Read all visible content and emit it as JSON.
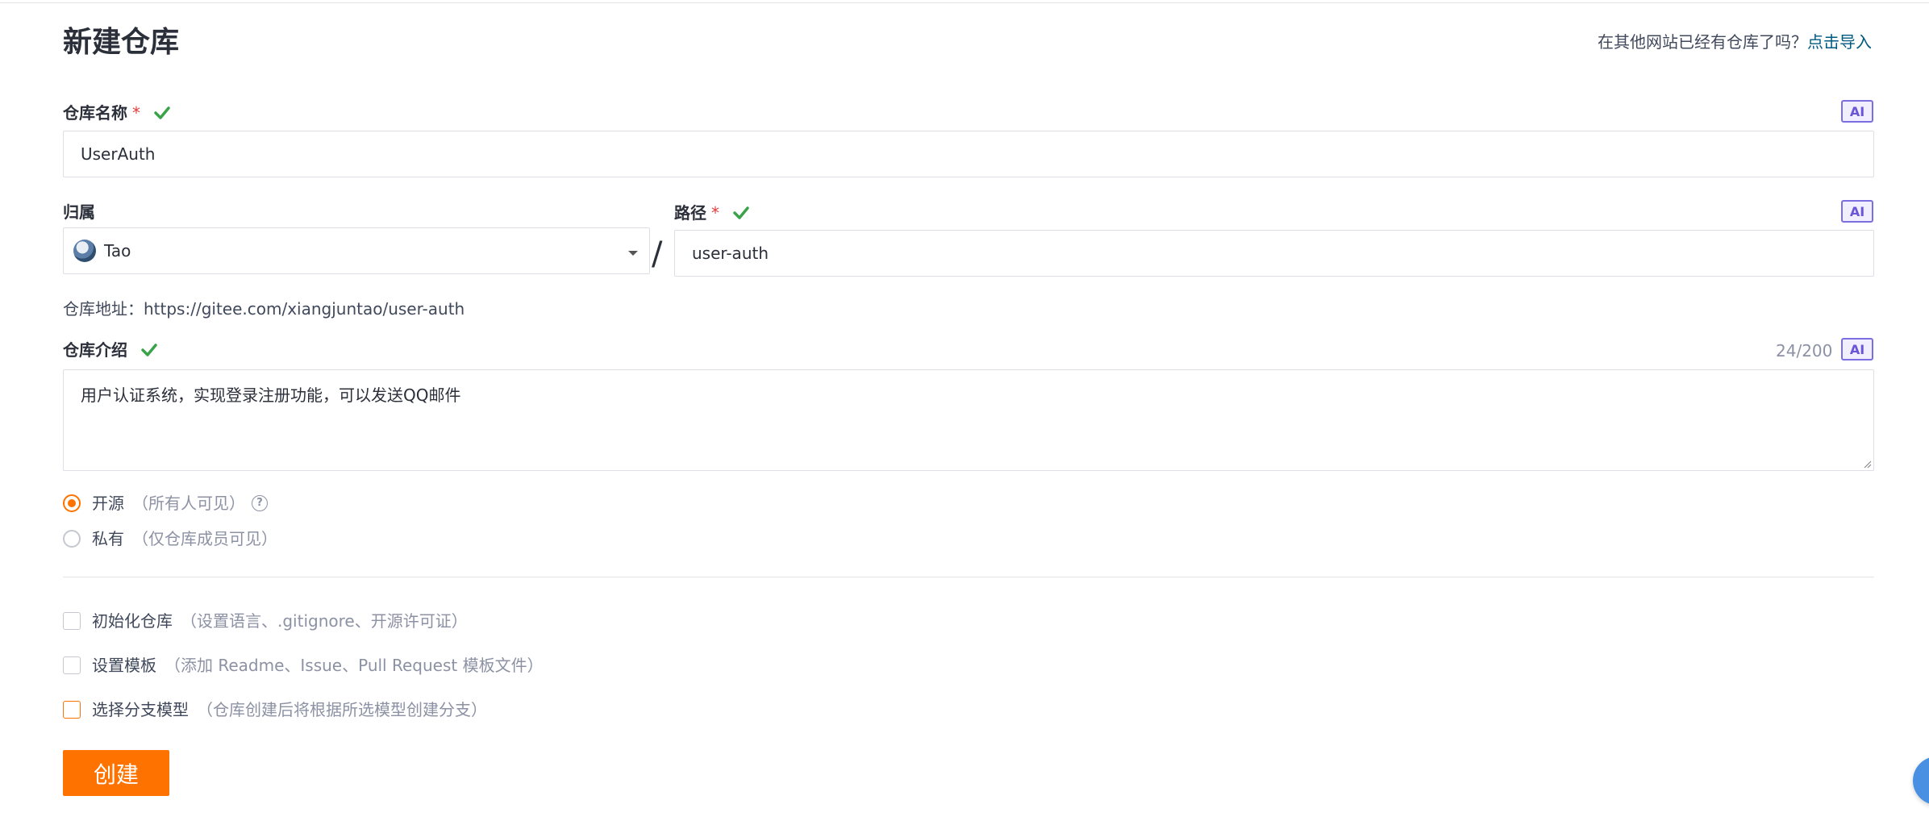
{
  "page": {
    "title": "新建仓库",
    "import_tip": "在其他网站已经有仓库了吗？",
    "import_link": "点击导入"
  },
  "ai_label": "AI",
  "required_mark": "*",
  "repo_name": {
    "label": "仓库名称",
    "value": "UserAuth"
  },
  "owner": {
    "label": "归属",
    "value": "Tao"
  },
  "separator": "/",
  "path": {
    "label": "路径",
    "value": "user-auth"
  },
  "address": {
    "prefix": "仓库地址：",
    "url": "https://gitee.com/xiangjuntao/user-auth"
  },
  "description": {
    "label": "仓库介绍",
    "counter": "24/200",
    "value": "用户认证系统，实现登录注册功能，可以发送QQ邮件"
  },
  "visibility": {
    "options": [
      {
        "label": "开源",
        "hint": "（所有人可见）",
        "selected": true
      },
      {
        "label": "私有",
        "hint": "（仅仓库成员可见）",
        "selected": false
      }
    ]
  },
  "options": [
    {
      "label": "初始化仓库",
      "hint": "（设置语言、.gitignore、开源许可证）",
      "checked": false
    },
    {
      "label": "设置模板",
      "hint": "（添加 Readme、Issue、Pull Request 模板文件）",
      "checked": false
    },
    {
      "label": "选择分支模型",
      "hint": "（仓库创建后将根据所选模型创建分支）",
      "checked": false
    }
  ],
  "create_button": "创建",
  "colors": {
    "accent": "#fe7300",
    "link": "#005980",
    "valid": "#3aa34a",
    "ai": "#6a55d8"
  }
}
